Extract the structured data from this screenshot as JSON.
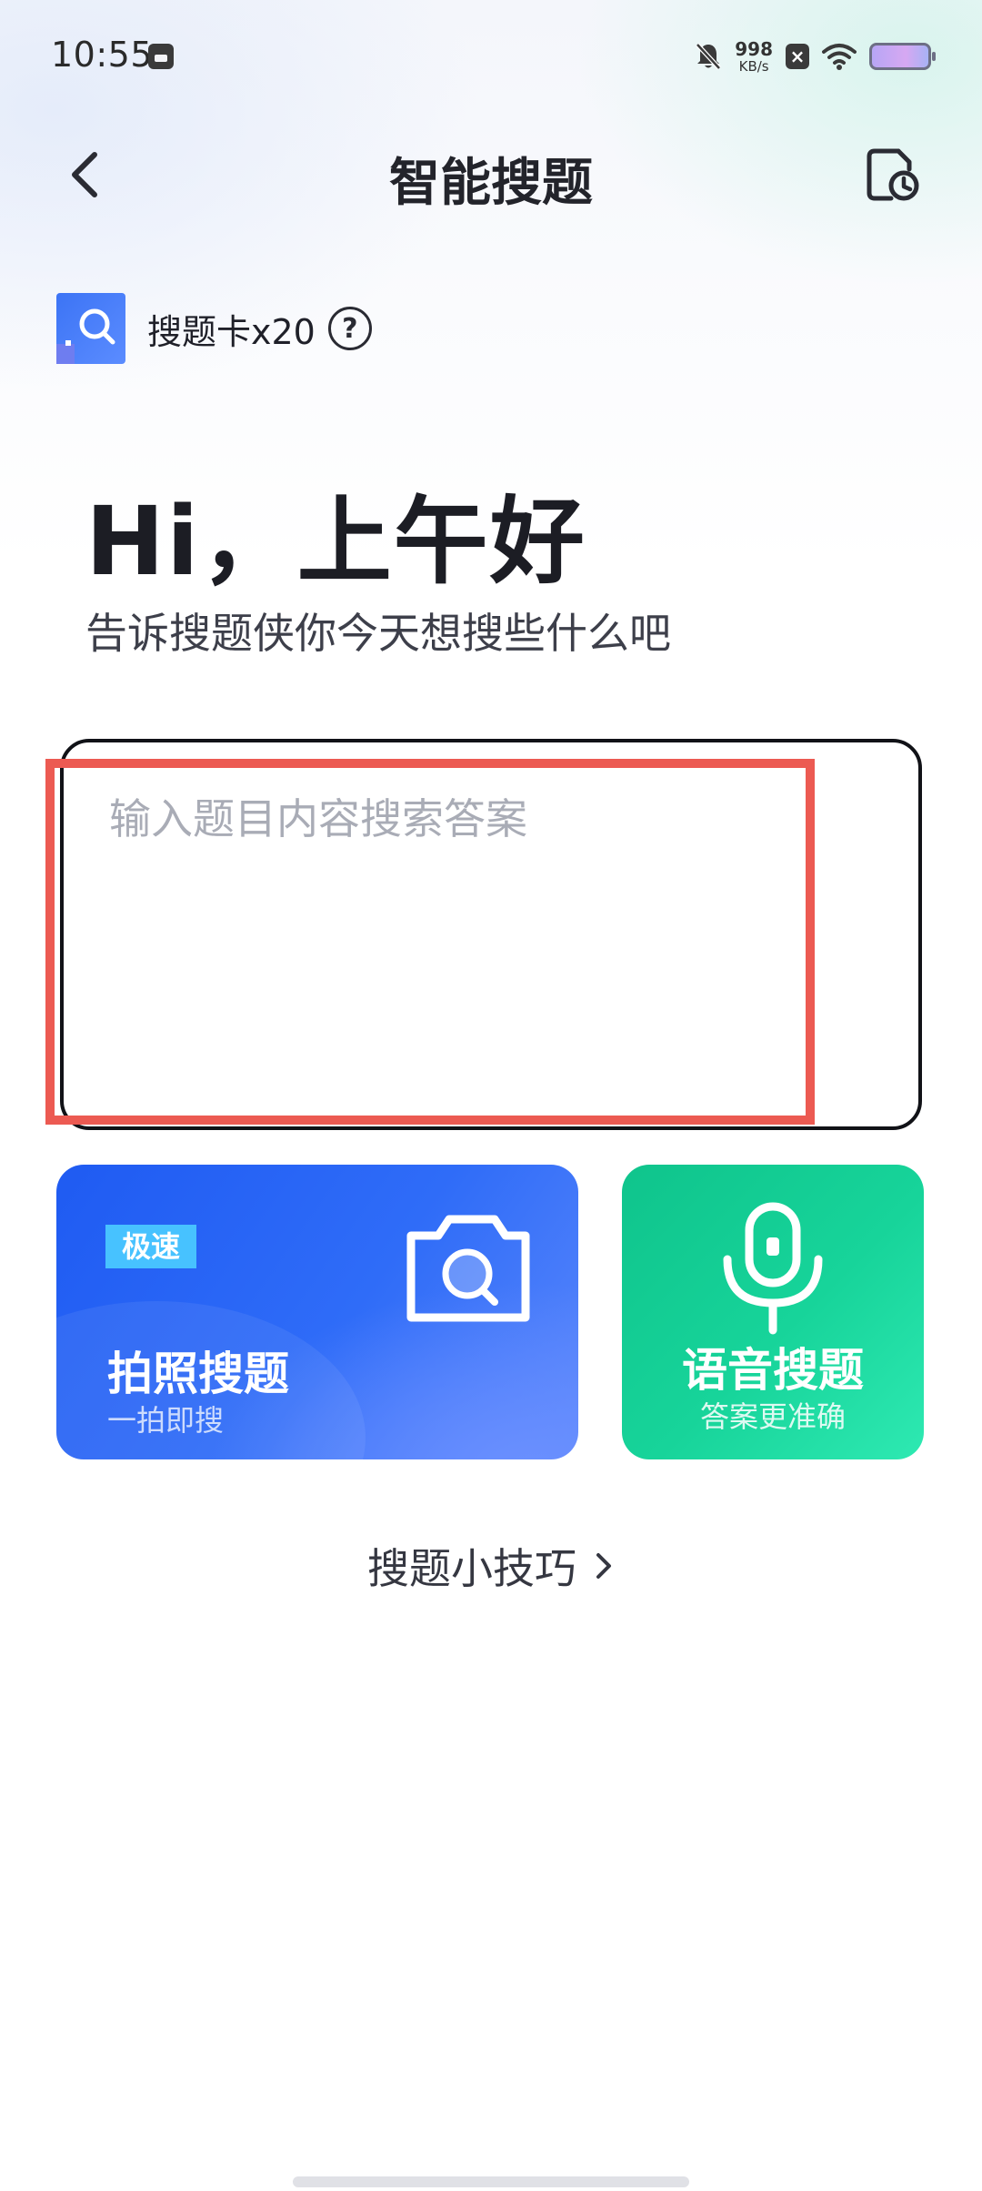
{
  "status_bar": {
    "time": "10:55",
    "net_speed_value": "998",
    "net_speed_unit": "KB/s",
    "icons": [
      "app-notification-icon",
      "bell-off-icon",
      "close-notification-icon",
      "wifi-icon",
      "battery-icon"
    ]
  },
  "header": {
    "title": "智能搜题",
    "back_icon": "chevron-left-icon",
    "history_icon": "history-icon"
  },
  "card_badge": {
    "label": "搜题卡x20",
    "help_symbol": "?"
  },
  "greeting": {
    "title": "Hi，上午好",
    "subtitle": "告诉搜题侠你今天想搜些什么吧"
  },
  "question_input": {
    "value": "",
    "placeholder": "输入题目内容搜索答案"
  },
  "actions": {
    "photo": {
      "tag": "极速",
      "title": "拍照搜题",
      "subtitle": "一拍即搜",
      "icon": "camera-search-icon"
    },
    "voice": {
      "title": "语音搜题",
      "subtitle": "答案更准确",
      "icon": "microphone-icon"
    }
  },
  "tips": {
    "label": "搜题小技巧"
  },
  "colors": {
    "photo_card": "#2f6cf8",
    "voice_card": "#17d49a",
    "speed_tag": "#47c2ff",
    "highlight": "#ec5a52",
    "text_primary": "#1c1d24"
  }
}
